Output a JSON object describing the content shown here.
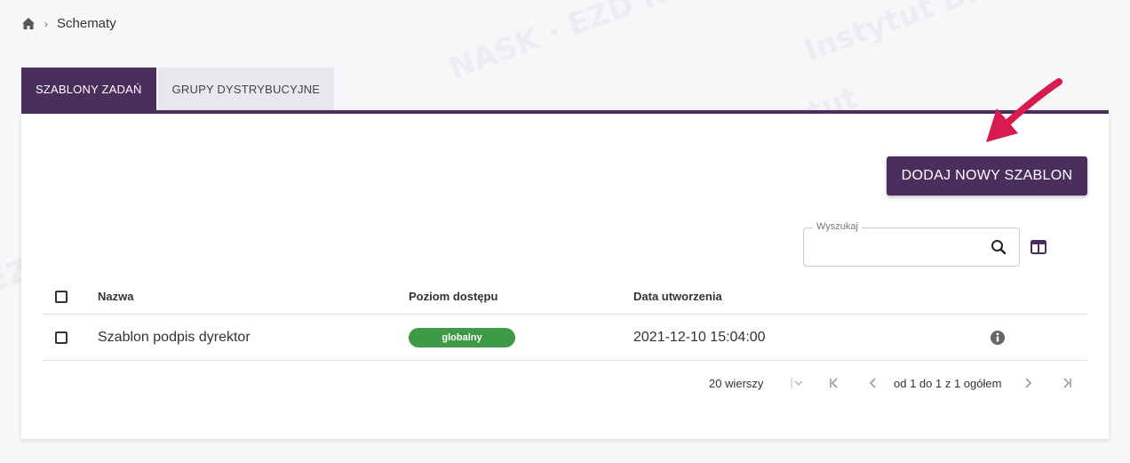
{
  "breadcrumb": {
    "home_icon": "home-icon",
    "current": "Schematy"
  },
  "tabs": [
    {
      "label": "SZABLONY ZADAŃ",
      "active": true
    },
    {
      "label": "GRUPY DYSTRYBUCYJNE",
      "active": false
    }
  ],
  "toolbar": {
    "add_label": "DODAJ NOWY SZABLON"
  },
  "search": {
    "label": "Wyszukaj",
    "value": ""
  },
  "table": {
    "columns": [
      "Nazwa",
      "Poziom dostępu",
      "Data utworzenia"
    ],
    "rows": [
      {
        "name": "Szablon podpis dyrektor",
        "level": "globalny",
        "created": "2021-12-10 15:04:00"
      }
    ]
  },
  "pager": {
    "rows_per_page": "20 wierszy",
    "range": "od 1 do 1 z 1 ogółem"
  },
  "colors": {
    "primary": "#4a2f5c",
    "badge": "#3f9a46",
    "arrow": "#d81b4f"
  }
}
